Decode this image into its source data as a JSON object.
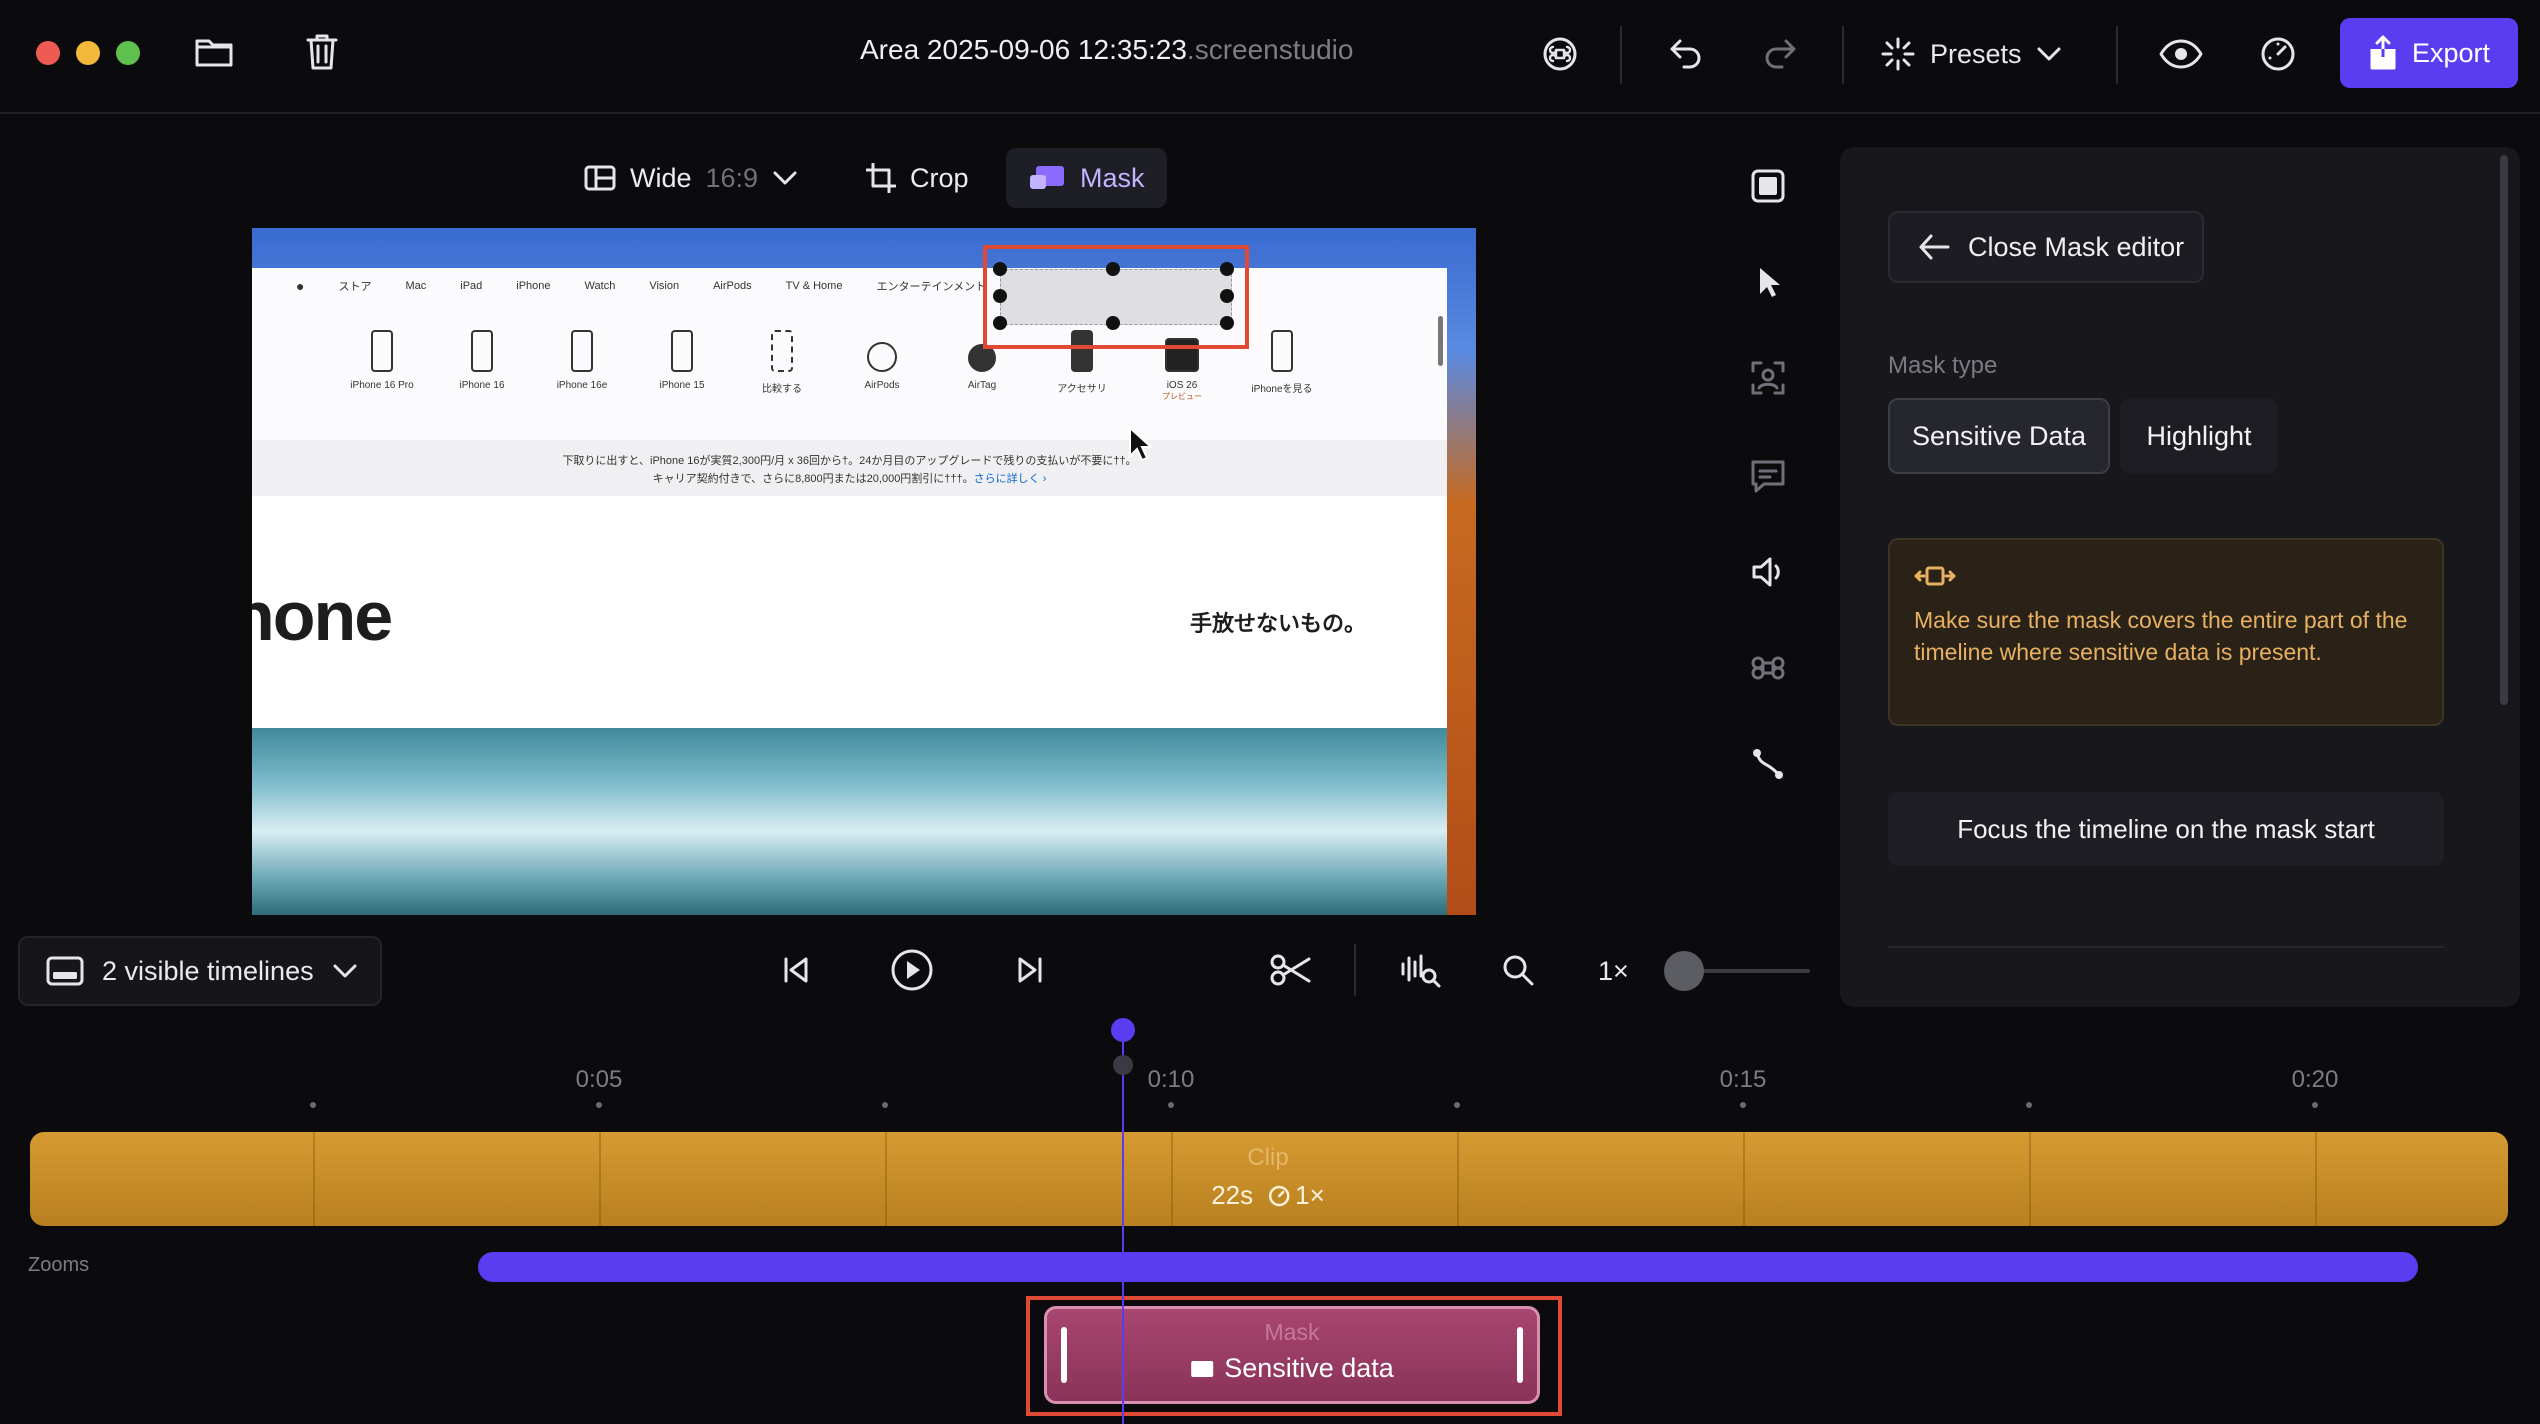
{
  "window": {
    "title": "Area 2025-09-06 12:35:23",
    "title_ext": ".screenstudio"
  },
  "toolbar": {
    "presets_label": "Presets",
    "export_label": "Export"
  },
  "preview_toolbar": {
    "aspect_label": "Wide",
    "aspect_ratio": "16:9",
    "crop_label": "Crop",
    "mask_label": "Mask"
  },
  "preview": {
    "nav_items": [
      "ストア",
      "Mac",
      "iPad",
      "iPhone",
      "Watch",
      "Vision",
      "AirPods",
      "TV & Home",
      "エンターテインメント"
    ],
    "products": [
      "iPhone 16 Pro",
      "iPhone 16",
      "iPhone 16e",
      "iPhone 15",
      "比較する",
      "AirPods",
      "AirTag",
      "アクセサリ",
      "iOS 26",
      "iPhoneを見る"
    ],
    "product_sub": "プレビュー",
    "notice_line1": "下取りに出すと、iPhone 16が実質2,300円/月 x 36回から†。24か月目のアップグレードで残りの支払いが不要に††。",
    "notice_line2": "キャリア契約付きで、さらに8,800円または20,000円割引に†††。",
    "notice_link": "さらに詳しく ›",
    "hero_word": "hone",
    "hero_tag": "手放せないもの。"
  },
  "panel": {
    "close_label": "Close Mask editor",
    "mask_type_label": "Mask type",
    "type_sensitive": "Sensitive Data",
    "type_highlight": "Highlight",
    "warning_text": "Make sure the mask covers the entire part of the timeline where sensitive data is present.",
    "focus_label": "Focus the timeline on the mask start"
  },
  "playback": {
    "visible_timelines": "2 visible timelines",
    "speed": "1×"
  },
  "timeline": {
    "ticks": [
      "0:05",
      "0:10",
      "0:15",
      "0:20"
    ],
    "clip_name": "Clip",
    "clip_duration": "22s",
    "clip_speed": "1×",
    "zooms_label": "Zooms",
    "mask_name": "Mask",
    "mask_label": "Sensitive data"
  },
  "colors": {
    "accent": "#5a3df0",
    "clip": "#c98f2a",
    "mask_clip": "#9a3d65",
    "selection": "#e04a35",
    "warning": "#e7b063"
  }
}
